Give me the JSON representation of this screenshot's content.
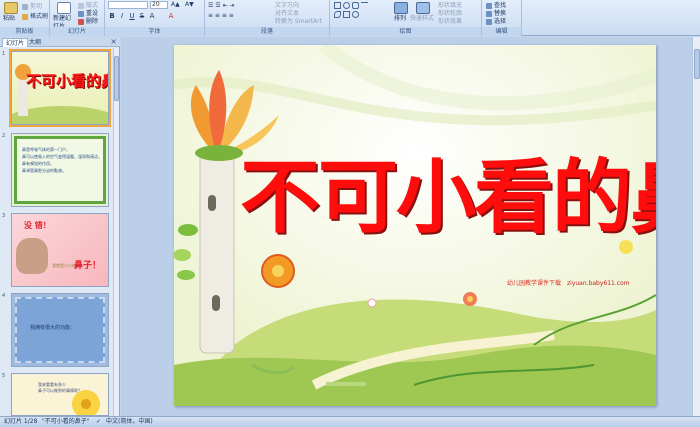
{
  "ribbon": {
    "groups": {
      "clipboard": {
        "label": "剪贴板",
        "paste": "粘贴",
        "cut": "剪切",
        "format_painter": "格式刷"
      },
      "slides": {
        "label": "幻灯片",
        "new_slide": "新建幻灯片",
        "layout": "版式",
        "reset": "重设",
        "delete": "删除"
      },
      "font": {
        "label": "字体",
        "font_size": "20",
        "bold": "B",
        "italic": "I",
        "underline": "U",
        "strikethrough": "S",
        "text_shadow": "A"
      },
      "paragraph": {
        "label": "段落",
        "text_direction": "文字方向",
        "align_text": "对齐文本",
        "convert_smartart": "转换为 SmartArt"
      },
      "drawing": {
        "label": "绘图",
        "arrange": "排列",
        "quick_styles": "快速样式",
        "shape_fill": "形状填充",
        "shape_outline": "形状轮廓",
        "shape_effects": "形状效果"
      },
      "editing": {
        "label": "编辑",
        "find": "查找",
        "replace": "替换",
        "select": "选择"
      }
    }
  },
  "left_pane": {
    "tabs": [
      "幻灯片",
      "大纲"
    ],
    "close": "×",
    "thumbnails": [
      {
        "number": "1",
        "title": "不可小看的鼻子"
      },
      {
        "number": "2",
        "lines": [
          "鼻是呼吸气体的第一门户，",
          "鼻可以使吸入的空气变得温暖、湿润和清洁，",
          "鼻有嗅觉的作用，",
          "鼻涕是鼻腔分泌的黏液。"
        ]
      },
      {
        "number": "3",
        "text_top": "没 错！",
        "text_small": "我就是小小的",
        "text_big": "鼻子！"
      },
      {
        "number": "4",
        "text": "我拥有很大的功能："
      },
      {
        "number": "5",
        "lines": [
          "我来看看有多少",
          "鼻子可以做到的事情呢？"
        ]
      }
    ]
  },
  "slide": {
    "title": "不可小看的鼻子",
    "watermark_text": "幼儿园教学课件下载",
    "watermark_url": "ziyuan.baby611.com"
  },
  "status_bar": {
    "slide_position": "幻灯片 1/28",
    "theme": "\"不可小看的鼻子\"",
    "language": "中文(简体，中国)"
  },
  "colors": {
    "title_red": "#ff0d0d",
    "ribbon_bg": "#dbe7f7",
    "selection": "#f0a640"
  }
}
